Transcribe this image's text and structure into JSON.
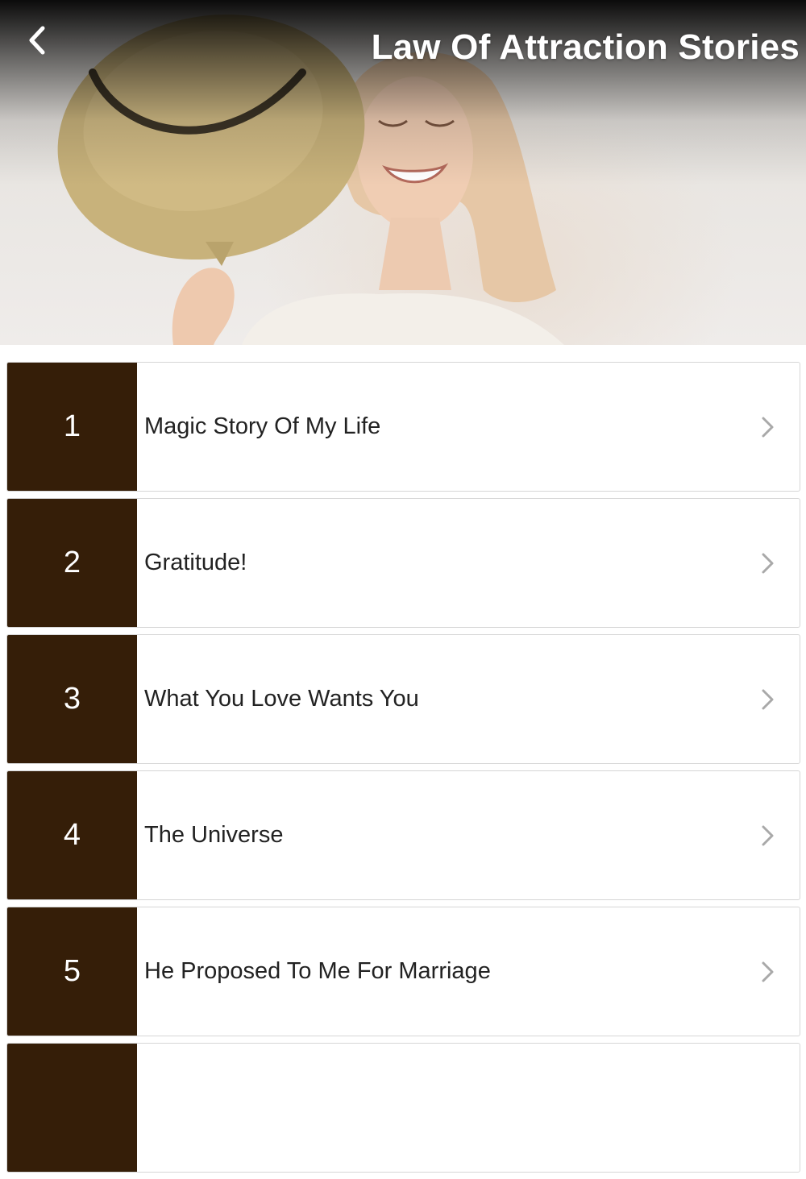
{
  "app": {
    "title": "Law Of Attraction Stories"
  },
  "icons": {
    "back": "chevron-left-icon",
    "row_arrow": "chevron-right-icon"
  },
  "colors": {
    "number_tile": "#351e08",
    "title_text": "#ffffff",
    "row_border": "#d6d6d6"
  },
  "stories": [
    {
      "number": "1",
      "title": "Magic Story Of My Life"
    },
    {
      "number": "2",
      "title": "Gratitude!"
    },
    {
      "number": "3",
      "title": "What You Love Wants You"
    },
    {
      "number": "4",
      "title": "The Universe"
    },
    {
      "number": "5",
      "title": "He Proposed To Me For Marriage"
    },
    {
      "number": "",
      "title": ""
    }
  ]
}
